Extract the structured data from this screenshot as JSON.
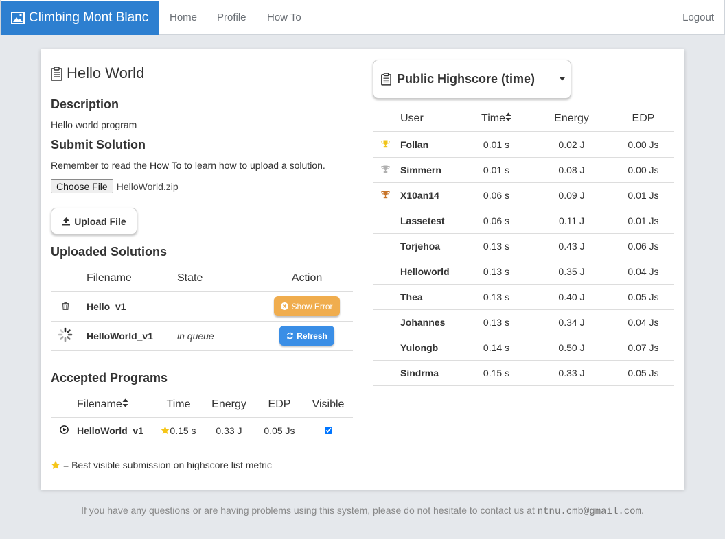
{
  "nav": {
    "brand": "Climbing Mont Blanc",
    "links": [
      "Home",
      "Profile",
      "How To"
    ],
    "logout": "Logout",
    "brand_color": "#2d7fd0"
  },
  "challenge": {
    "title": "Hello World",
    "description_heading": "Description",
    "description": "Hello world program",
    "submit_heading": "Submit Solution",
    "remember_before": "Remember to read the ",
    "remember_link": "How To",
    "remember_after": " to learn how to upload a solution.",
    "choose_file_label": "Choose File",
    "selected_file": "HelloWorld.zip",
    "upload_label": "Upload File"
  },
  "uploaded": {
    "heading": "Uploaded Solutions",
    "columns": [
      "Filename",
      "State",
      "Action"
    ],
    "rows": [
      {
        "icon": "trash-icon",
        "filename": "Hello_v1",
        "state": "",
        "action": "Show Error",
        "action_color": "#f0ad4e"
      },
      {
        "icon": "spinner-icon",
        "filename": "HelloWorld_v1",
        "state": "in queue",
        "action": "Refresh",
        "action_color": "#3a8ee6"
      }
    ]
  },
  "accepted": {
    "heading": "Accepted Programs",
    "columns": [
      "Filename",
      "Time",
      "Energy",
      "EDP",
      "Visible"
    ],
    "rows": [
      {
        "filename": "HelloWorld_v1",
        "time": "0.15 s",
        "energy": "0.33 J",
        "edp": "0.05 Js",
        "visible": true,
        "best": true
      }
    ],
    "note": "= Best visible submission on highscore list metric"
  },
  "highscore": {
    "button_label": "Public Highscore (time)",
    "columns": [
      "User",
      "Time",
      "Energy",
      "EDP"
    ],
    "rows": [
      {
        "trophy": "gold",
        "user": "Follan",
        "time": "0.01 s",
        "energy": "0.02 J",
        "edp": "0.00 Js"
      },
      {
        "trophy": "silver",
        "user": "Simmern",
        "time": "0.01 s",
        "energy": "0.08 J",
        "edp": "0.00 Js"
      },
      {
        "trophy": "bronze",
        "user": "X10an14",
        "time": "0.06 s",
        "energy": "0.09 J",
        "edp": "0.01 Js"
      },
      {
        "trophy": "",
        "user": "Lassetest",
        "time": "0.06 s",
        "energy": "0.11 J",
        "edp": "0.01 Js"
      },
      {
        "trophy": "",
        "user": "Torjehoa",
        "time": "0.13 s",
        "energy": "0.43 J",
        "edp": "0.06 Js"
      },
      {
        "trophy": "",
        "user": "Helloworld",
        "time": "0.13 s",
        "energy": "0.35 J",
        "edp": "0.04 Js"
      },
      {
        "trophy": "",
        "user": "Thea",
        "time": "0.13 s",
        "energy": "0.40 J",
        "edp": "0.05 Js"
      },
      {
        "trophy": "",
        "user": "Johannes",
        "time": "0.13 s",
        "energy": "0.34 J",
        "edp": "0.04 Js"
      },
      {
        "trophy": "",
        "user": "Yulongb",
        "time": "0.14 s",
        "energy": "0.50 J",
        "edp": "0.07 Js"
      },
      {
        "trophy": "",
        "user": "Sindrma",
        "time": "0.15 s",
        "energy": "0.33 J",
        "edp": "0.05 Js"
      }
    ],
    "trophy_colors": {
      "gold": "#f0c419",
      "silver": "#b0b0b0",
      "bronze": "#c8752a"
    }
  },
  "footer": {
    "text": "If you have any questions or are having problems using this system, please do not hesitate to contact us at ",
    "email": "ntnu.cmb@gmail.com",
    "end": "."
  }
}
